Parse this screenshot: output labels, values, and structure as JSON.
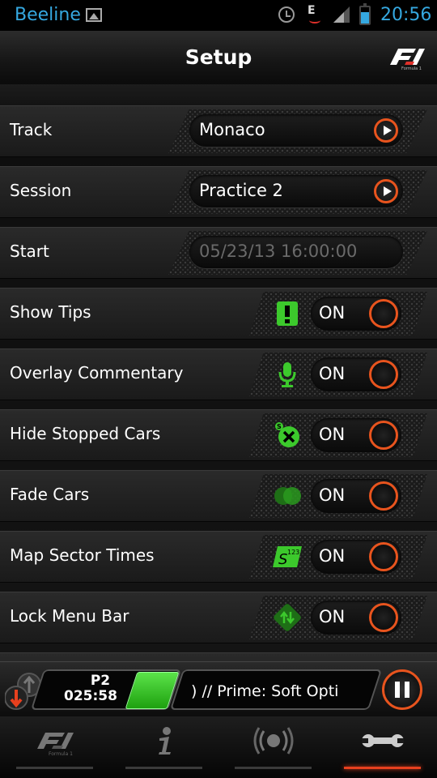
{
  "status_bar": {
    "carrier": "Beeline",
    "time": "20:56",
    "battery_level": 0.7,
    "colors": {
      "accent": "#35a8e0"
    }
  },
  "header": {
    "title": "Setup",
    "logo": "f1-logo"
  },
  "settings": {
    "track": {
      "label": "Track",
      "value": "Monaco"
    },
    "session": {
      "label": "Session",
      "value": "Practice 2"
    },
    "start": {
      "label": "Start",
      "value": "05/23/13 16:00:00"
    },
    "toggles": [
      {
        "label": "Show Tips",
        "state": "ON",
        "icon": "exclamation-icon"
      },
      {
        "label": "Overlay Commentary",
        "state": "ON",
        "icon": "microphone-icon"
      },
      {
        "label": "Hide Stopped Cars",
        "state": "ON",
        "icon": "stopped-car-icon"
      },
      {
        "label": "Fade Cars",
        "state": "ON",
        "icon": "fade-cars-icon"
      },
      {
        "label": "Map Sector Times",
        "state": "ON",
        "icon": "sector-times-icon"
      },
      {
        "label": "Lock Menu Bar",
        "state": "ON",
        "icon": "lock-menu-icon"
      }
    ]
  },
  "race_bar": {
    "position": "P2",
    "time": "025:58",
    "ticker": ")  //  Prime: Soft Opti",
    "flag_color": "#3cc92c"
  },
  "tabs": [
    {
      "name": "f1-tab",
      "icon": "f1-logo-icon",
      "active": false
    },
    {
      "name": "info-tab",
      "icon": "info-icon",
      "active": false
    },
    {
      "name": "broadcast-tab",
      "icon": "broadcast-icon",
      "active": false
    },
    {
      "name": "setup-tab",
      "icon": "wrench-icon",
      "active": true
    }
  ],
  "colors": {
    "accent_orange": "#e8541e",
    "green": "#3cc92c",
    "background": "#141414"
  }
}
